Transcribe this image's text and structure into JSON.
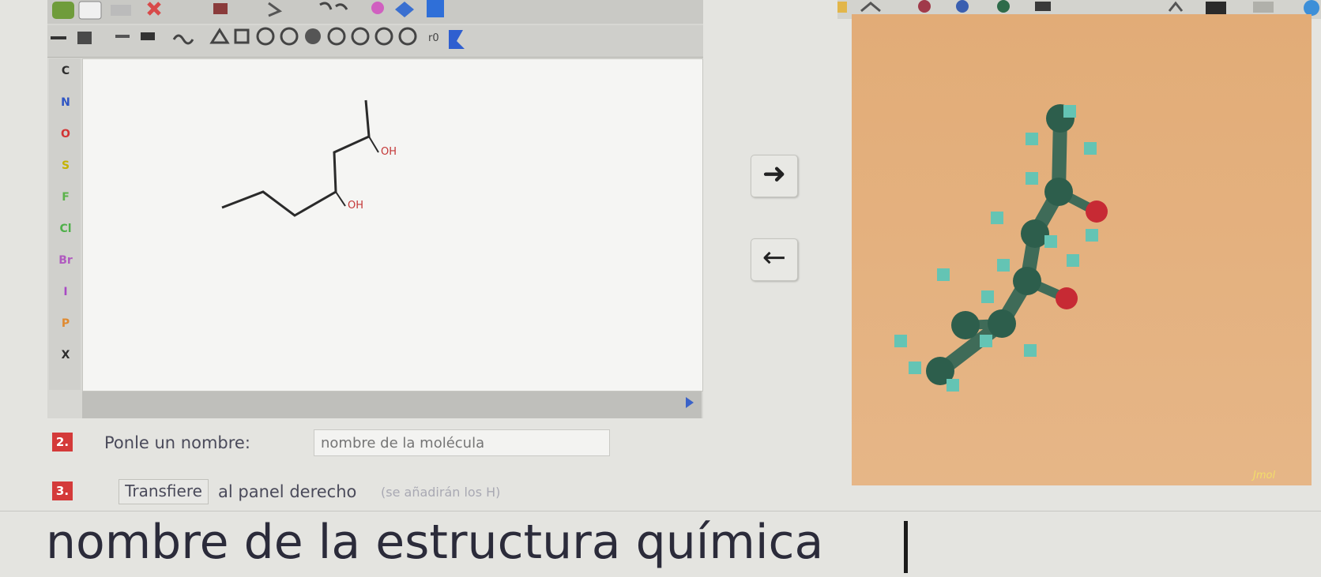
{
  "editor": {
    "toolbar_top": [
      "select-tool",
      "eraser-tool",
      "bond-tool",
      "undo-tool",
      "redo-tool",
      "template-tool",
      "atom-map-tool",
      "info-tool"
    ],
    "elements": [
      {
        "symbol": "C",
        "color": "#2d2d2d"
      },
      {
        "symbol": "N",
        "color": "#2f55c4"
      },
      {
        "symbol": "O",
        "color": "#d23535"
      },
      {
        "symbol": "S",
        "color": "#c4b200"
      },
      {
        "symbol": "F",
        "color": "#5bb34a"
      },
      {
        "symbol": "Cl",
        "color": "#4fb04a"
      },
      {
        "symbol": "Br",
        "color": "#b05abf"
      },
      {
        "symbol": "I",
        "color": "#a84ac4"
      },
      {
        "symbol": "P",
        "color": "#e08a30"
      },
      {
        "symbol": "X",
        "color": "#2d2d2d"
      }
    ],
    "molecule_labels": [
      "OH",
      "OH"
    ]
  },
  "arrows": {
    "right": "➜",
    "left": "←"
  },
  "viewer": {
    "label": "Jmol"
  },
  "steps": [
    {
      "number": "2.",
      "text": "Ponle un nombre:",
      "input_placeholder": "nombre de la molécula"
    },
    {
      "number": "3.",
      "button": "Transfiere",
      "text": "al panel derecho",
      "note": "(se añadirán los H)"
    }
  ],
  "bottom": {
    "text": "nombre de la estructura química"
  }
}
